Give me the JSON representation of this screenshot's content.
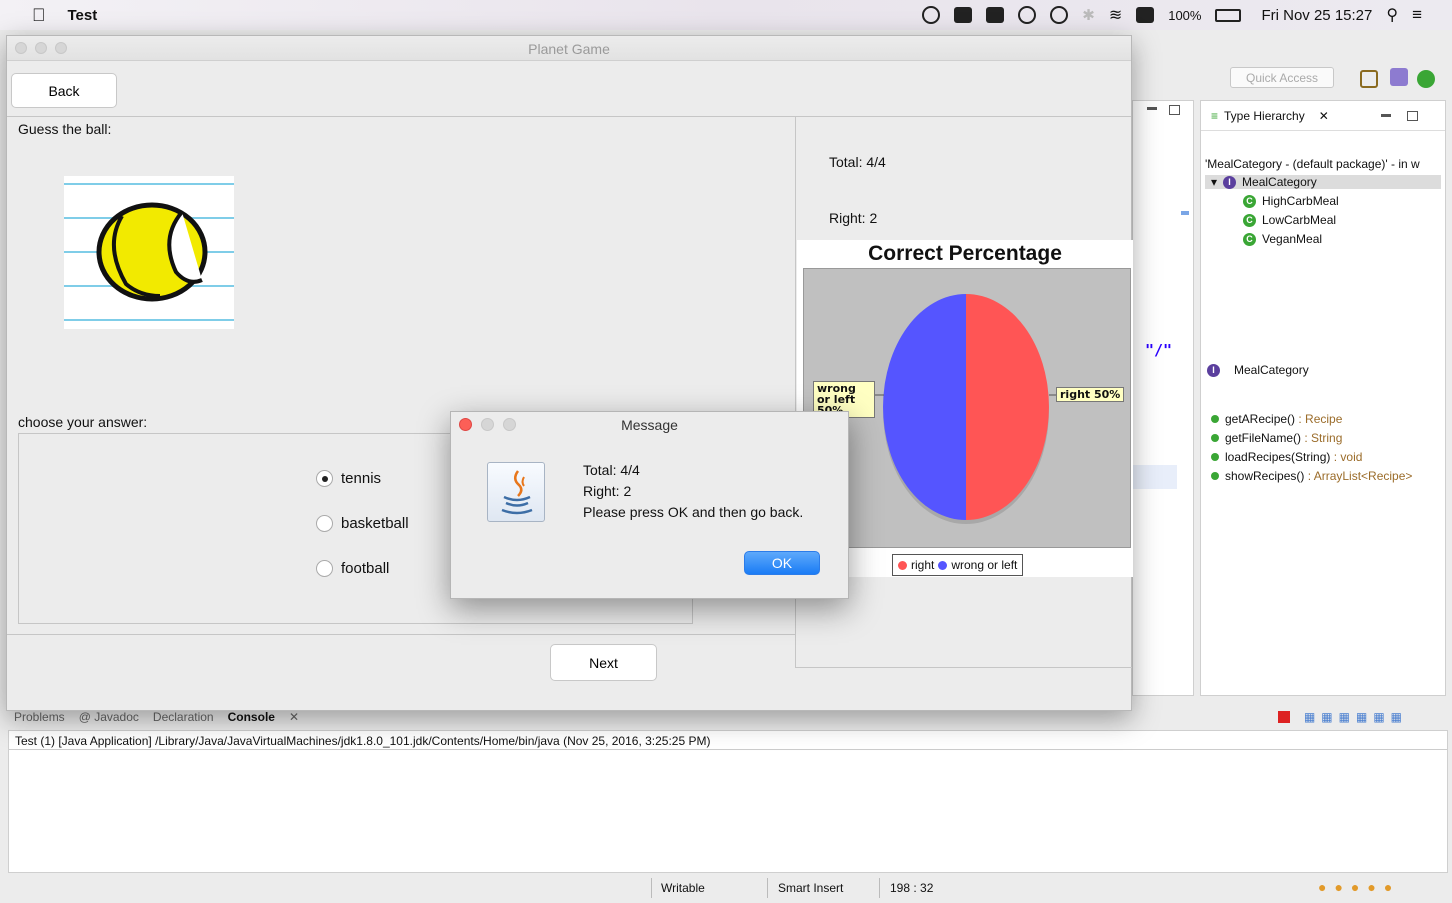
{
  "menubar": {
    "app_name": "Test",
    "battery": "100%",
    "clock": "Fri Nov 25  15:27"
  },
  "eclipse": {
    "quick_access_placeholder": "Quick Access",
    "editor_fragment": "\"/\"",
    "type_hierarchy": {
      "tab_label": "Type Hierarchy",
      "path": "'MealCategory - (default package)' - in w",
      "root": "MealCategory",
      "subclasses": [
        "HighCarbMeal",
        "LowCarbMeal",
        "VeganMeal"
      ],
      "members_title": "MealCategory",
      "methods": [
        {
          "name": "getARecipe()",
          "ret": " : Recipe"
        },
        {
          "name": "getFileName()",
          "ret": " : String"
        },
        {
          "name": "loadRecipes(String)",
          "ret": " : void"
        },
        {
          "name": "showRecipes()",
          "ret": " : ArrayList<Recipe>"
        }
      ]
    },
    "bottom_tabs": [
      "Problems",
      "@ Javadoc",
      "Declaration",
      "Console"
    ],
    "console_line": "Test (1) [Java Application] /Library/Java/JavaVirtualMachines/jdk1.8.0_101.jdk/Contents/Home/bin/java (Nov 25, 2016, 3:25:25 PM)",
    "status": {
      "writable": "Writable",
      "insert_mode": "Smart Insert",
      "position": "198 : 32"
    }
  },
  "game": {
    "window_title": "Planet Game",
    "back_label": "Back",
    "guess_label": "Guess the ball:",
    "choose_label": "choose your answer:",
    "options": [
      {
        "label": "tennis",
        "selected": true
      },
      {
        "label": "basketball",
        "selected": false
      },
      {
        "label": "football",
        "selected": false
      }
    ],
    "next_label": "Next",
    "total_text": "Total: 4/4",
    "right_text": "Right: 2"
  },
  "chart_data": {
    "type": "pie",
    "title": "Correct Percentage",
    "slices": [
      {
        "name": "right",
        "value": 50,
        "color": "#ff5555"
      },
      {
        "name": "wrong or left",
        "value": 50,
        "color": "#5555ff"
      }
    ],
    "slice_labels": [
      "right 50%",
      "wrong or left 50%"
    ],
    "legend": [
      "right",
      "wrong or left"
    ],
    "legend_position": "bottom"
  },
  "dialog": {
    "title": "Message",
    "lines": [
      "Total: 4/4",
      "Right: 2",
      "Please press OK and then go back."
    ],
    "ok_label": "OK"
  }
}
